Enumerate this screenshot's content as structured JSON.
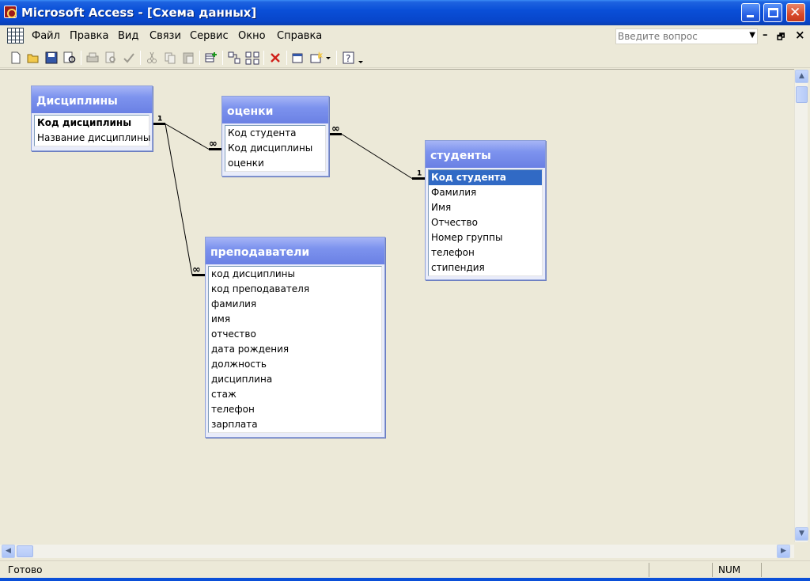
{
  "window": {
    "title": "Microsoft Access - [Схема данных]",
    "controls": {
      "minimize": "minimize-icon",
      "maximize": "maximize-icon",
      "close": "✕"
    }
  },
  "menu": {
    "items": [
      "Файл",
      "Правка",
      "Вид",
      "Связи",
      "Сервис",
      "Окно",
      "Справка"
    ],
    "help_placeholder": "Введите вопрос",
    "mdi_minimize": "–",
    "mdi_restore": "🗗",
    "mdi_close": "×"
  },
  "toolbar": {
    "icons": [
      "new-icon",
      "open-icon",
      "save-icon",
      "file-search-icon",
      "print-icon",
      "print-preview-icon",
      "spelling-icon",
      "cut-icon",
      "copy-icon",
      "paste-icon",
      "show-table-icon",
      "show-direct-icon",
      "show-all-icon",
      "delete-icon",
      "new-object-icon",
      "new-object-dropdown-icon",
      "help-icon"
    ]
  },
  "diagram": {
    "tables": [
      {
        "title": "Дисциплины",
        "fields": [
          "Код дисциплины",
          "Название дисциплины"
        ],
        "pk": [
          0
        ],
        "selected": []
      },
      {
        "title": "оценки",
        "fields": [
          "Код студента",
          "Код дисциплины",
          "оценки"
        ],
        "pk": [],
        "selected": []
      },
      {
        "title": "студенты",
        "fields": [
          "Код студента",
          "Фамилия",
          "Имя",
          "Отчество",
          "Номер группы",
          "телефон",
          "стипендия"
        ],
        "pk": [
          0
        ],
        "selected": [
          0
        ]
      },
      {
        "title": "преподаватели",
        "fields": [
          "код дисциплины",
          "код преподавателя",
          "фамилия",
          "имя",
          "отчество",
          "дата рождения",
          "должность",
          "дисциплина",
          "стаж",
          "телефон",
          "зарплата"
        ],
        "pk": [],
        "selected": []
      }
    ],
    "relationships": [
      {
        "from_table": "Дисциплины",
        "from_field": "Код дисциплины",
        "from_label": "1",
        "to_table": "оценки",
        "to_field": "Код дисциплины",
        "to_label": "∞"
      },
      {
        "from_table": "студенты",
        "from_field": "Код студента",
        "from_label": "1",
        "to_table": "оценки",
        "to_field": "Код студента",
        "to_label": "∞"
      },
      {
        "from_table": "Дисциплины",
        "from_field": "Код дисциплины",
        "from_label": "1",
        "to_table": "преподаватели",
        "to_field": "код дисциплины",
        "to_label": "∞"
      }
    ]
  },
  "scrollbars": {
    "up": "▲",
    "down": "▼",
    "left": "◀",
    "right": "▶"
  },
  "status": {
    "text": "Готово",
    "num": "NUM"
  }
}
